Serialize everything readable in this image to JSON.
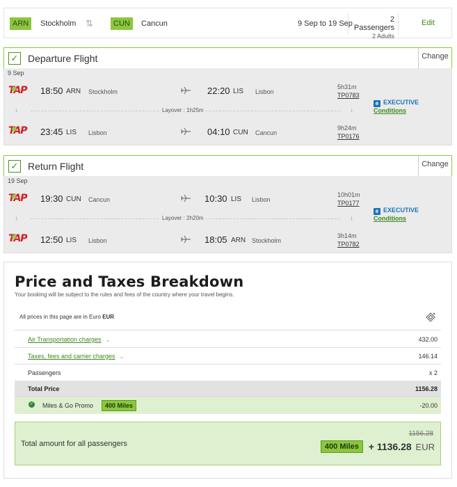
{
  "summary": {
    "origin_code": "ARN",
    "origin_city": "Stockholm",
    "destination_code": "CUN",
    "destination_city": "Cancun",
    "dates": "9 Sep to 19 Sep",
    "passengers": "2 Passengers",
    "passengers_sub": "2 Adults",
    "edit_label": "Edit"
  },
  "departure": {
    "title": "Departure Flight",
    "change_label": "Change",
    "date": "9 Sep",
    "cabin": "EXECUTIVE",
    "conditions": "Conditions",
    "layover": "Layover : 1h25m",
    "segments": [
      {
        "dep_time": "18:50",
        "dep_code": "ARN",
        "dep_city": "Stockholm",
        "arr_time": "22:20",
        "arr_code": "LIS",
        "arr_city": "Lisbon",
        "duration": "5h31m",
        "flight_no": "TP0783"
      },
      {
        "dep_time": "23:45",
        "dep_code": "LIS",
        "dep_city": "Lisbon",
        "arr_time": "04:10",
        "arr_code": "CUN",
        "arr_city": "Cancun",
        "duration": "9h24m",
        "flight_no": "TP0176"
      }
    ]
  },
  "return": {
    "title": "Return Flight",
    "change_label": "Change",
    "date": "19 Sep",
    "cabin": "EXECUTIVE",
    "conditions": "Conditions",
    "layover": "Layover : 2h20m",
    "segments": [
      {
        "dep_time": "19:30",
        "dep_code": "CUN",
        "dep_city": "Cancun",
        "arr_time": "10:30",
        "arr_code": "LIS",
        "arr_city": "Lisbon",
        "duration": "10h01m",
        "flight_no": "TP0177"
      },
      {
        "dep_time": "12:50",
        "dep_code": "LIS",
        "dep_city": "Lisbon",
        "arr_time": "18:05",
        "arr_code": "ARN",
        "arr_city": "Stockholm",
        "duration": "3h14m",
        "flight_no": "TP0782"
      }
    ]
  },
  "airline_logo_text": "TAP",
  "price": {
    "title": "Price and Taxes Breakdown",
    "subtitle": "Your booking will be subject to the rules and fees of the country where your travel begins.",
    "currency_note": "All prices in this page are in Euro",
    "currency_code": "EUR",
    "rows": {
      "air_label": "Air Transportation charges",
      "air_value": "432.00",
      "taxes_label": "Taxes, fees and carrier charges",
      "taxes_value": "146.14",
      "pax_label": "Passengers",
      "pax_value": "x 2",
      "total_label": "Total Price",
      "total_value": "1156.28",
      "promo_label": "Miles & Go Promo",
      "promo_miles": "400 Miles",
      "promo_value": "-20.00"
    },
    "final": {
      "label": "Total amount for all passengers",
      "old_total": "1156.28",
      "miles": "400 Miles",
      "plus": "+",
      "amount": "1136.28",
      "currency": "EUR"
    }
  },
  "colors": {
    "brand_green": "#8cc63f",
    "link_green": "#3c8a1b",
    "executive_blue": "#1a74b8",
    "tap_red": "#d71920"
  }
}
